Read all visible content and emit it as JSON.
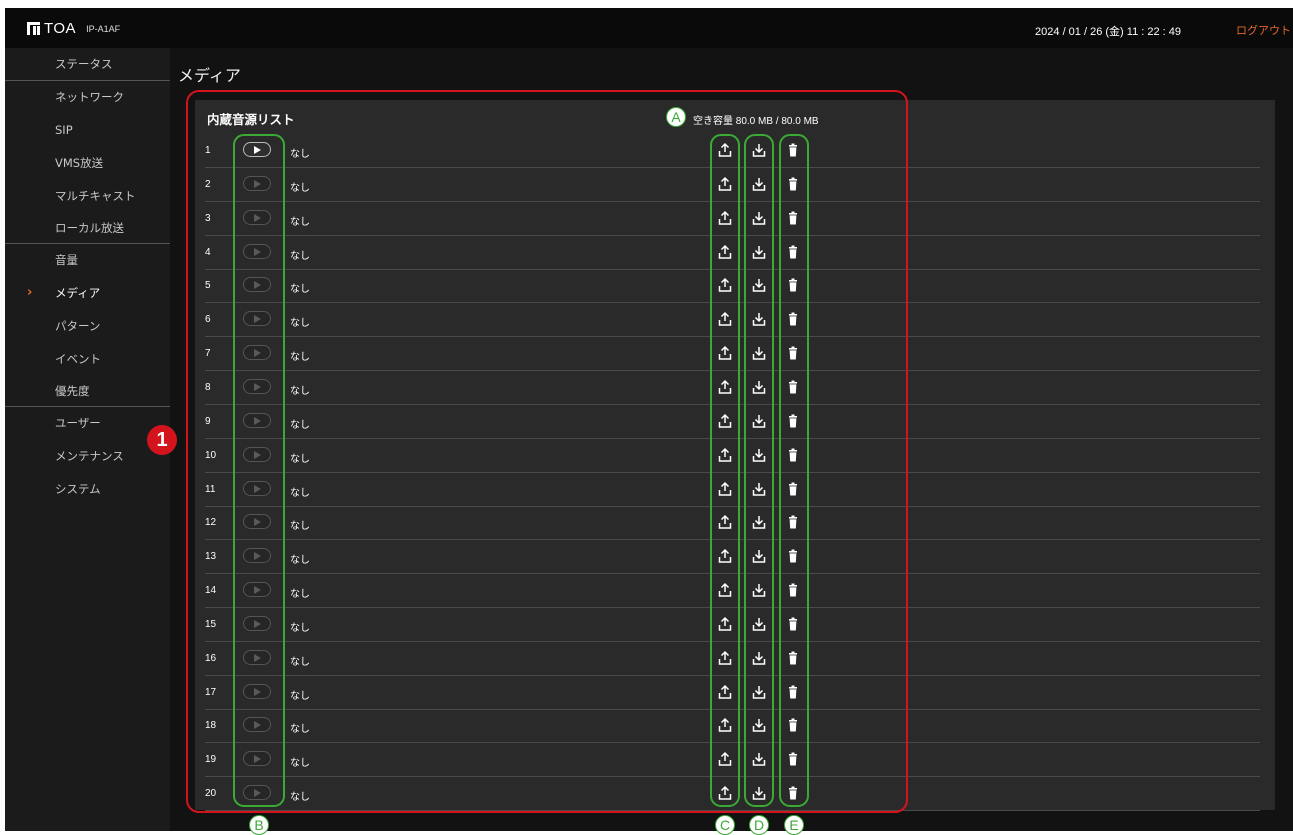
{
  "header": {
    "brand": "TOA",
    "model": "IP-A1AF",
    "datetime": "2024 / 01 / 26 (金)  11 : 22 : 49",
    "logout_label": "ログアウト"
  },
  "sidebar": {
    "items": [
      {
        "label": "ステータス"
      },
      {
        "label": "ネットワーク"
      },
      {
        "label": "SIP"
      },
      {
        "label": "VMS放送"
      },
      {
        "label": "マルチキャスト"
      },
      {
        "label": "ローカル放送"
      },
      {
        "label": "音量"
      },
      {
        "label": "メディア",
        "active": true
      },
      {
        "label": "パターン"
      },
      {
        "label": "イベント"
      },
      {
        "label": "優先度"
      },
      {
        "label": "ユーザー"
      },
      {
        "label": "メンテナンス"
      },
      {
        "label": "システム"
      }
    ]
  },
  "page": {
    "title": "メディア",
    "list_title": "内蔵音源リスト",
    "capacity": "空き容量 80.0 MB / 80.0 MB"
  },
  "rows": [
    {
      "num": "1",
      "name": "なし"
    },
    {
      "num": "2",
      "name": "なし"
    },
    {
      "num": "3",
      "name": "なし"
    },
    {
      "num": "4",
      "name": "なし"
    },
    {
      "num": "5",
      "name": "なし"
    },
    {
      "num": "6",
      "name": "なし"
    },
    {
      "num": "7",
      "name": "なし"
    },
    {
      "num": "8",
      "name": "なし"
    },
    {
      "num": "9",
      "name": "なし"
    },
    {
      "num": "10",
      "name": "なし"
    },
    {
      "num": "11",
      "name": "なし"
    },
    {
      "num": "12",
      "name": "なし"
    },
    {
      "num": "13",
      "name": "なし"
    },
    {
      "num": "14",
      "name": "なし"
    },
    {
      "num": "15",
      "name": "なし"
    },
    {
      "num": "16",
      "name": "なし"
    },
    {
      "num": "17",
      "name": "なし"
    },
    {
      "num": "18",
      "name": "なし"
    },
    {
      "num": "19",
      "name": "なし"
    },
    {
      "num": "20",
      "name": "なし"
    }
  ],
  "icons": {
    "play": "play-icon",
    "upload": "upload-icon",
    "download": "download-icon",
    "delete": "trash-icon"
  },
  "annotations": {
    "one": "1",
    "a": "A",
    "b": "B",
    "c": "C",
    "d": "D",
    "e": "E"
  },
  "colors": {
    "accent": "#e66a2c",
    "annotation_red": "#d4141c",
    "annotation_green": "#3aaa35"
  }
}
